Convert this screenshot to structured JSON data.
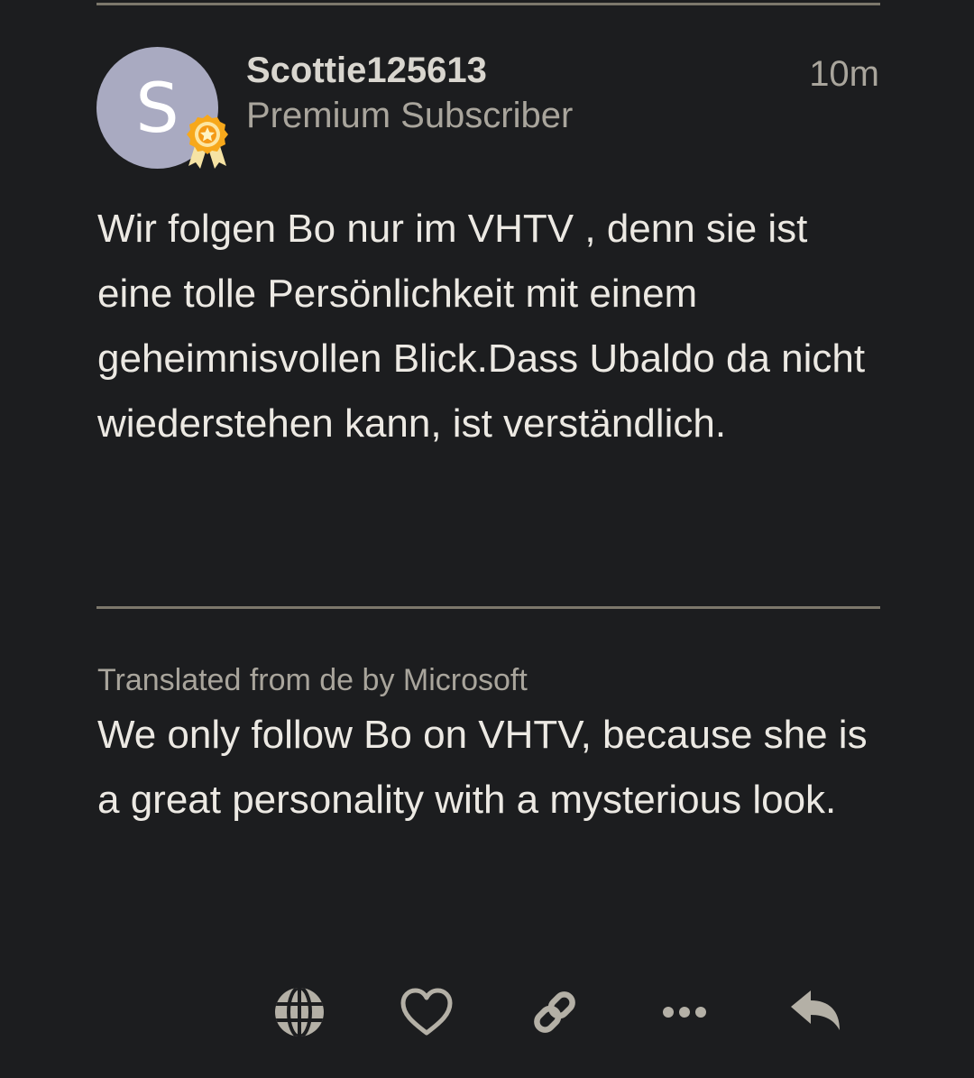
{
  "post": {
    "author": {
      "avatar_letter": "S",
      "avatar_color": "#a9aac1",
      "username": "Scottie125613",
      "role": "Premium Subscriber",
      "badge_icon": "award-ribbon-icon"
    },
    "time": "10m",
    "original_text": "Wir folgen Bo nur im VHTV , denn sie ist eine tolle Persönlichkeit mit einem geheimnisvollen Blick.Dass Ubaldo da nicht wiederstehen kann, ist verständlich.",
    "translation": {
      "attribution": "Translated from de by Microsoft",
      "text": "We only follow Bo on VHTV, because she is a great personality with a mysterious look."
    },
    "actions": [
      {
        "name": "translate",
        "icon": "globe-icon"
      },
      {
        "name": "like",
        "icon": "heart-icon"
      },
      {
        "name": "copy-link",
        "icon": "link-icon"
      },
      {
        "name": "more",
        "icon": "ellipsis-icon"
      },
      {
        "name": "reply",
        "icon": "reply-icon"
      }
    ]
  },
  "colors": {
    "background": "#1c1d1f",
    "primary_text": "#ece9e3",
    "secondary_text": "#a9a59c",
    "divider": "#7c776b",
    "icon": "#b4b0a6",
    "badge": "#f5a623"
  }
}
